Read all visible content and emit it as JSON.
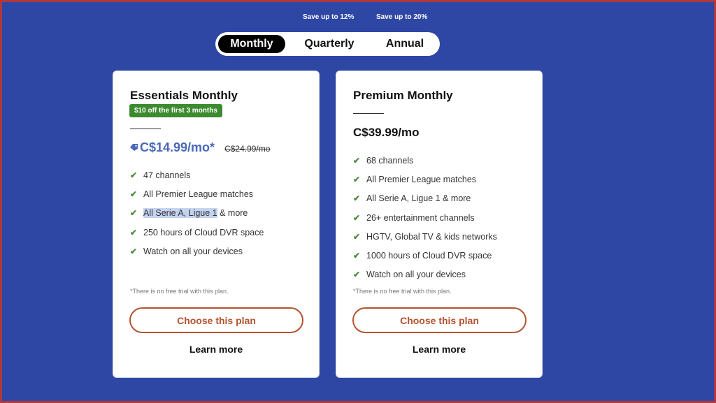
{
  "billing": {
    "savings": {
      "quarterly": "Save up to 12%",
      "annual": "Save up to 20%"
    },
    "options": [
      {
        "label": "Monthly",
        "selected": true
      },
      {
        "label": "Quarterly",
        "selected": false
      },
      {
        "label": "Annual",
        "selected": false
      }
    ]
  },
  "plans": [
    {
      "title": "Essentials Monthly",
      "badge": "$10 off the first 3 months",
      "price": "C$14.99/mo*",
      "old_price": "C$24.99/mo",
      "price_icon": "tag-icon",
      "features": [
        "47 channels",
        "All Premier League matches",
        "All Serie A, Ligue 1",
        "250 hours of Cloud DVR space",
        "Watch on all your devices"
      ],
      "feature_3_suffix": " & more",
      "disclaimer": "*There is no free trial with this plan.",
      "cta": "Choose this plan",
      "learn_more": "Learn more"
    },
    {
      "title": "Premium Monthly",
      "price": "C$39.99/mo",
      "features": [
        "68 channels",
        "All Premier League matches",
        "All Serie A, Ligue 1 & more",
        "26+ entertainment channels",
        "HGTV, Global TV & kids networks",
        "1000 hours of Cloud DVR space",
        "Watch on all your devices"
      ],
      "disclaimer": "*There is no free trial with this plan.",
      "cta": "Choose this plan",
      "learn_more": "Learn more"
    }
  ],
  "icons": {
    "check": "✔"
  },
  "colors": {
    "background": "#2e47a5",
    "frame": "#b0383f",
    "promo_green": "#3d8b2f",
    "sale_price": "#4a68b8",
    "cta": "#b4532f",
    "check": "#4a8a3a",
    "text_highlight": "#c4d3f0"
  }
}
